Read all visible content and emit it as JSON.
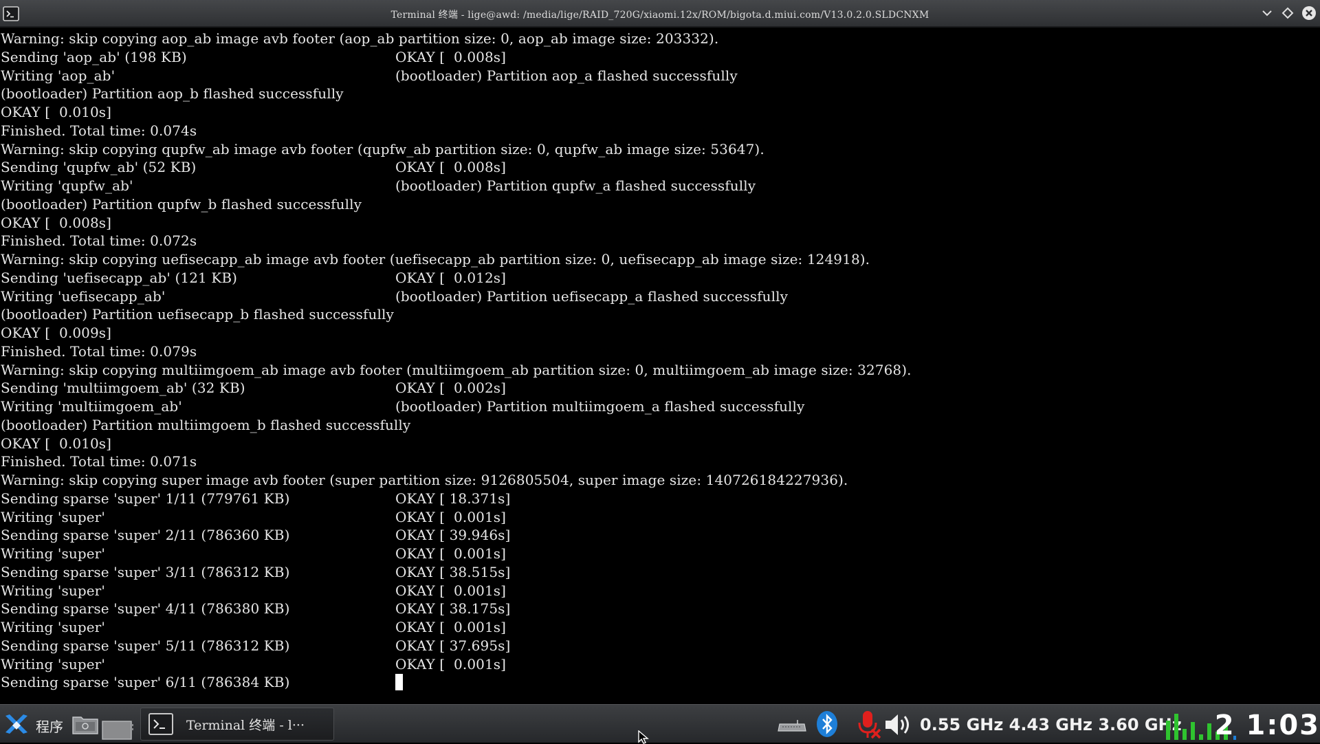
{
  "window": {
    "title": "Terminal 终端 - lige@awd: /media/lige/RAID_720G/xiaomi.12x/ROM/bigota.d.miui.com/V13.0.2.0.SLDCNXM"
  },
  "terminal": {
    "lines": [
      {
        "left": "Warning: skip copying aop_ab image avb footer (aop_ab partition size: 0, aop_ab image size: 203332).",
        "right": ""
      },
      {
        "left": "Sending 'aop_ab' (198 KB)",
        "right": "OKAY [  0.008s]"
      },
      {
        "left": "Writing 'aop_ab'",
        "right": "(bootloader) Partition aop_a flashed successfully"
      },
      {
        "left": "(bootloader) Partition aop_b flashed successfully",
        "right": ""
      },
      {
        "left": "OKAY [  0.010s]",
        "right": ""
      },
      {
        "left": "Finished. Total time: 0.074s",
        "right": ""
      },
      {
        "left": "Warning: skip copying qupfw_ab image avb footer (qupfw_ab partition size: 0, qupfw_ab image size: 53647).",
        "right": ""
      },
      {
        "left": "Sending 'qupfw_ab' (52 KB)",
        "right": "OKAY [  0.008s]"
      },
      {
        "left": "Writing 'qupfw_ab'",
        "right": "(bootloader) Partition qupfw_a flashed successfully"
      },
      {
        "left": "(bootloader) Partition qupfw_b flashed successfully",
        "right": ""
      },
      {
        "left": "OKAY [  0.008s]",
        "right": ""
      },
      {
        "left": "Finished. Total time: 0.072s",
        "right": ""
      },
      {
        "left": "Warning: skip copying uefisecapp_ab image avb footer (uefisecapp_ab partition size: 0, uefisecapp_ab image size: 124918).",
        "right": ""
      },
      {
        "left": "Sending 'uefisecapp_ab' (121 KB)",
        "right": "OKAY [  0.012s]"
      },
      {
        "left": "Writing 'uefisecapp_ab'",
        "right": "(bootloader) Partition uefisecapp_a flashed successfully"
      },
      {
        "left": "(bootloader) Partition uefisecapp_b flashed successfully",
        "right": ""
      },
      {
        "left": "OKAY [  0.009s]",
        "right": ""
      },
      {
        "left": "Finished. Total time: 0.079s",
        "right": ""
      },
      {
        "left": "Warning: skip copying multiimgoem_ab image avb footer (multiimgoem_ab partition size: 0, multiimgoem_ab image size: 32768).",
        "right": ""
      },
      {
        "left": "Sending 'multiimgoem_ab' (32 KB)",
        "right": "OKAY [  0.002s]"
      },
      {
        "left": "Writing 'multiimgoem_ab'",
        "right": "(bootloader) Partition multiimgoem_a flashed successfully"
      },
      {
        "left": "(bootloader) Partition multiimgoem_b flashed successfully",
        "right": ""
      },
      {
        "left": "OKAY [  0.010s]",
        "right": ""
      },
      {
        "left": "Finished. Total time: 0.071s",
        "right": ""
      },
      {
        "left": "Warning: skip copying super image avb footer (super partition size: 9126805504, super image size: 140726184227936).",
        "right": ""
      },
      {
        "left": "Sending sparse 'super' 1/11 (779761 KB)",
        "right": "OKAY [ 18.371s]"
      },
      {
        "left": "Writing 'super'",
        "right": "OKAY [  0.001s]"
      },
      {
        "left": "Sending sparse 'super' 2/11 (786360 KB)",
        "right": "OKAY [ 39.946s]"
      },
      {
        "left": "Writing 'super'",
        "right": "OKAY [  0.001s]"
      },
      {
        "left": "Sending sparse 'super' 3/11 (786312 KB)",
        "right": "OKAY [ 38.515s]"
      },
      {
        "left": "Writing 'super'",
        "right": "OKAY [  0.001s]"
      },
      {
        "left": "Sending sparse 'super' 4/11 (786380 KB)",
        "right": "OKAY [ 38.175s]"
      },
      {
        "left": "Writing 'super'",
        "right": "OKAY [  0.001s]"
      },
      {
        "left": "Sending sparse 'super' 5/11 (786312 KB)",
        "right": "OKAY [ 37.695s]"
      },
      {
        "left": "Writing 'super'",
        "right": "OKAY [  0.001s]"
      },
      {
        "left": "Sending sparse 'super' 6/11 (786384 KB)",
        "right": ""
      }
    ]
  },
  "taskbar": {
    "start_label": "程序",
    "task_label": "Terminal 终端 - l···",
    "cpu_freqs": "0.55 GHz 4.43 GHz 3.60 GHz",
    "clock": "2 1:03"
  },
  "icons": {
    "app": "terminal-icon",
    "minimize": "chevron-down-icon",
    "maximize": "diamond-icon",
    "close": "close-icon",
    "start": "start-menu-icon",
    "folder": "file-manager-icon",
    "show_desktop": "desktop-icon",
    "keyboard": "keyboard-icon",
    "bluetooth": "bluetooth-icon",
    "microphone": "microphone-muted-icon",
    "volume": "volume-icon",
    "cpu": "cpu-meter-icon"
  },
  "colors": {
    "terminal_bg": "#000000",
    "terminal_fg": "#e7e7e7",
    "bluetooth": "#1e7fd8",
    "mic_muted": "#e0201d",
    "cpu_bar": "#2fc42f"
  }
}
